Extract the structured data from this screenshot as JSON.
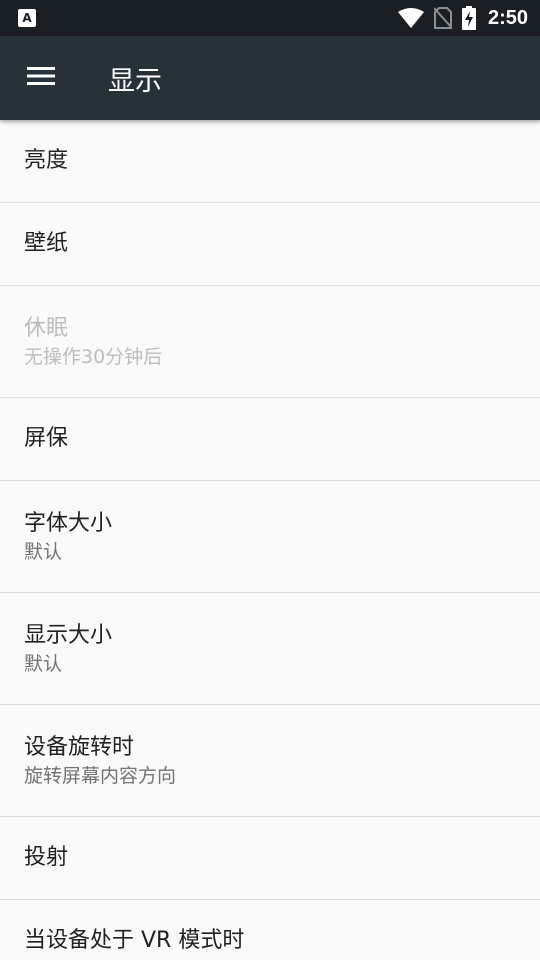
{
  "status_bar": {
    "notification_icon": "A",
    "time": "2:50",
    "icons": [
      "wifi-icon",
      "no-sim-icon",
      "battery-charging-icon"
    ]
  },
  "app_bar": {
    "title": "显示",
    "menu_icon": "hamburger-menu-icon"
  },
  "settings": [
    {
      "title": "亮度",
      "summary": null,
      "enabled": true
    },
    {
      "title": "壁纸",
      "summary": null,
      "enabled": true
    },
    {
      "title": "休眠",
      "summary": "无操作30分钟后",
      "enabled": false
    },
    {
      "title": "屏保",
      "summary": null,
      "enabled": true
    },
    {
      "title": "字体大小",
      "summary": "默认",
      "enabled": true
    },
    {
      "title": "显示大小",
      "summary": "默认",
      "enabled": true
    },
    {
      "title": "设备旋转时",
      "summary": "旋转屏幕内容方向",
      "enabled": true
    },
    {
      "title": "投射",
      "summary": null,
      "enabled": true
    },
    {
      "title": "当设备处于 VR 模式时",
      "summary": null,
      "enabled": true
    }
  ],
  "colors": {
    "status_bar": "#1a1f23",
    "app_bar": "#263238",
    "background": "#fafafa",
    "title_text": "#212121",
    "summary_text": "#737373",
    "disabled_text": "#bdbdbd"
  }
}
